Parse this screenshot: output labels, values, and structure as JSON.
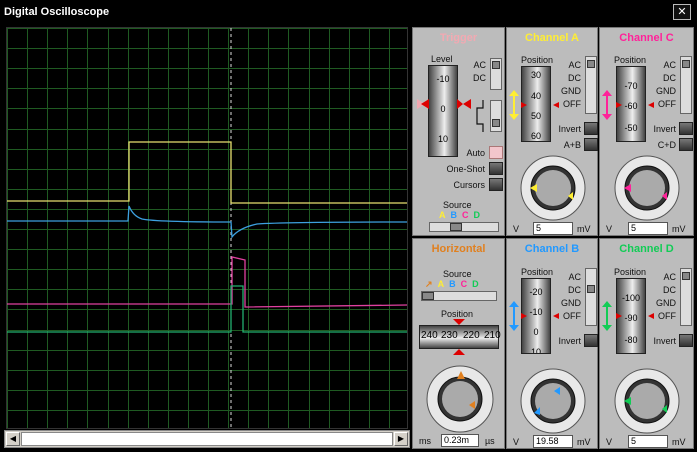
{
  "window": {
    "title": "Digital Oscilloscope",
    "close": "✕"
  },
  "colors": {
    "trigger": "#f2a9b2",
    "channel_a": "#ffee33",
    "channel_b": "#2299ff",
    "channel_c": "#ff2299",
    "channel_d": "#11cc55",
    "horizontal": "#e08020",
    "grid": "#1f5a22",
    "trace_a": "#e8e070",
    "trace_b": "#3da0e0",
    "trace_c": "#e040a0",
    "trace_d": "#22b070"
  },
  "trigger": {
    "title": "Trigger",
    "level_label": "Level",
    "level_ticks": [
      "-10",
      "0",
      "10"
    ],
    "coupling": [
      "AC",
      "DC"
    ],
    "modes": [
      "Auto",
      "One-Shot",
      "Cursors"
    ],
    "source_label": "Source",
    "sources": [
      "A",
      "B",
      "C",
      "D"
    ]
  },
  "horizontal": {
    "title": "Horizontal",
    "source_label": "Source",
    "sources": [
      "A",
      "B",
      "C",
      "D"
    ],
    "position_label": "Position",
    "position_ticks": [
      "240",
      "230",
      "220",
      "210"
    ],
    "dial_scale": [
      "0.5",
      "1",
      "2",
      "5",
      "10",
      "20",
      "50",
      "100",
      "200",
      "0.1",
      "0.2"
    ],
    "unit_left": "ms",
    "value": "0.23m",
    "unit_right": "µs"
  },
  "channel_a": {
    "title": "Channel A",
    "position_label": "Position",
    "position_ticks": [
      "30",
      "40",
      "50",
      "60"
    ],
    "coupling": [
      "AC",
      "DC",
      "GND",
      "OFF"
    ],
    "invert_label": "Invert",
    "combine_label": "A+B",
    "dial_scale": [
      "0.5",
      "1",
      "0.2",
      "2",
      "0.1",
      "5",
      "10",
      "2",
      "20",
      "1",
      "5",
      "10",
      "50",
      "20",
      "0.5"
    ],
    "unit_left": "V",
    "value": "5",
    "unit_right": "mV"
  },
  "channel_b": {
    "title": "Channel B",
    "position_label": "Position",
    "position_ticks": [
      "-20",
      "-10",
      "0",
      "10"
    ],
    "coupling": [
      "AC",
      "DC",
      "GND",
      "OFF"
    ],
    "invert_label": "Invert",
    "dial_scale": [
      "0.5",
      "1",
      "0.2",
      "2",
      "0.1",
      "5",
      "10",
      "2",
      "20",
      "1",
      "5",
      "10",
      "50",
      "20",
      "0.5"
    ],
    "unit_left": "V",
    "value": "19.58",
    "unit_right": "mV"
  },
  "channel_c": {
    "title": "Channel C",
    "position_label": "Position",
    "position_ticks": [
      "-70",
      "-60",
      "-50"
    ],
    "coupling": [
      "AC",
      "DC",
      "GND",
      "OFF"
    ],
    "invert_label": "Invert",
    "combine_label": "C+D",
    "dial_scale": [
      "0.5",
      "1",
      "0.2",
      "2",
      "0.1",
      "5",
      "10",
      "2",
      "20",
      "1",
      "5",
      "10",
      "50",
      "20",
      "0.5"
    ],
    "unit_left": "V",
    "value": "5",
    "unit_right": "mV"
  },
  "channel_d": {
    "title": "Channel D",
    "position_label": "Position",
    "position_ticks": [
      "-100",
      "-90",
      "-80"
    ],
    "coupling": [
      "AC",
      "DC",
      "GND",
      "OFF"
    ],
    "invert_label": "Invert",
    "dial_scale": [
      "0.5",
      "1",
      "0.2",
      "2",
      "0.1",
      "5",
      "10",
      "2",
      "20",
      "1",
      "5",
      "10",
      "50",
      "20",
      "0.5"
    ],
    "unit_left": "V",
    "value": "5",
    "unit_right": "mV"
  }
}
